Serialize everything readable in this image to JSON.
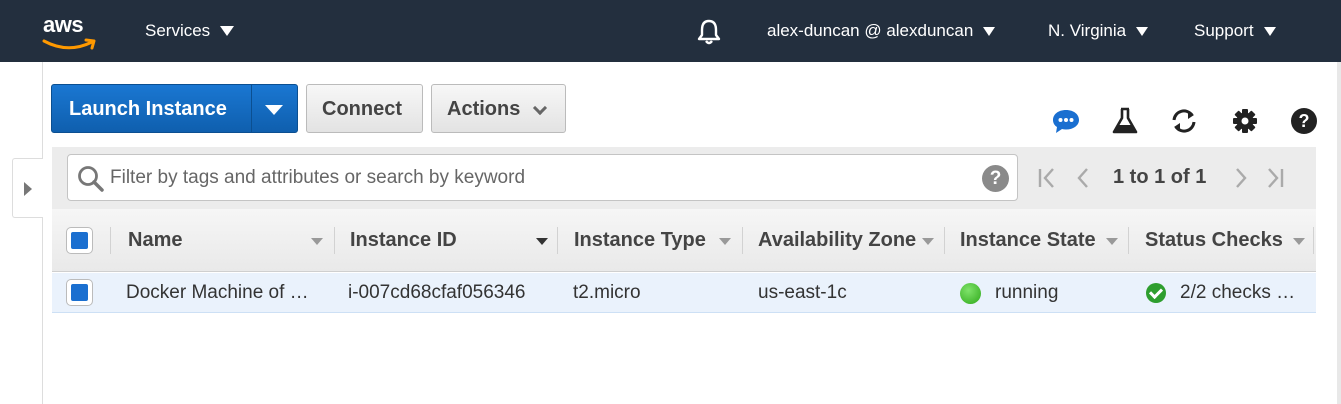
{
  "nav": {
    "logo": "aws",
    "services": "Services",
    "account": "alex-duncan @ alexduncan",
    "region": "N. Virginia",
    "support": "Support"
  },
  "toolbar": {
    "launch_label": "Launch Instance",
    "connect_label": "Connect",
    "actions_label": "Actions",
    "icons": [
      "chat-icon",
      "flask-icon",
      "refresh-icon",
      "gear-icon",
      "help-icon"
    ]
  },
  "search": {
    "placeholder": "Filter by tags and attributes or search by keyword",
    "help": "?"
  },
  "pagination": {
    "text": "1 to 1 of 1"
  },
  "table": {
    "columns": [
      "Name",
      "Instance ID",
      "Instance Type",
      "Availability Zone",
      "Instance State",
      "Status Checks"
    ],
    "rows": [
      {
        "name": "Docker Machine of …",
        "instance_id": "i-007cd68cfaf056346",
        "instance_type": "t2.micro",
        "availability_zone": "us-east-1c",
        "instance_state": "running",
        "status_checks": "2/2 checks …"
      }
    ]
  },
  "colors": {
    "nav_bg": "#232f3e",
    "primary": "#1a6fd0",
    "running": "#2ea81a"
  }
}
